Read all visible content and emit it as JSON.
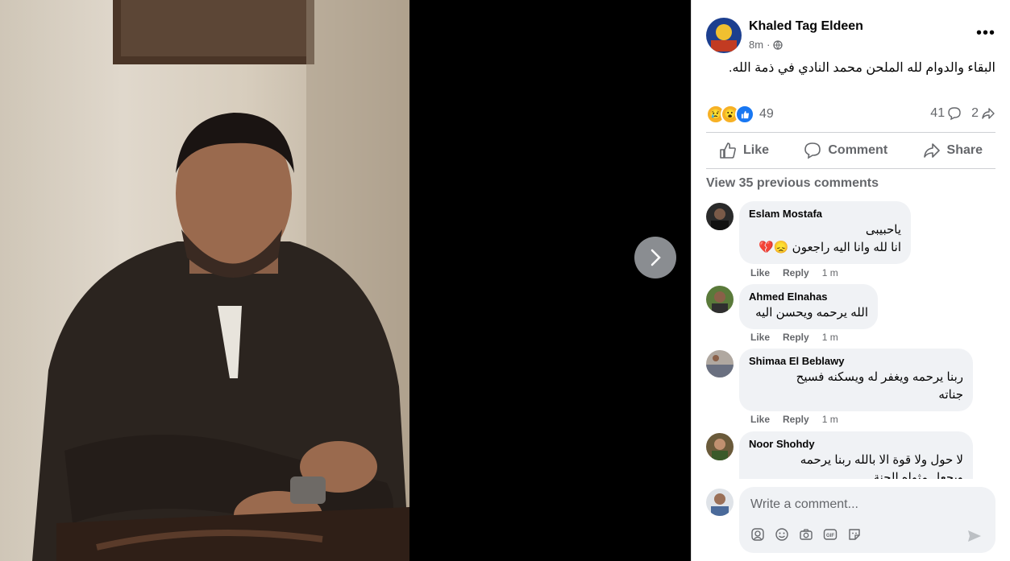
{
  "post": {
    "author": "Khaled Tag Eldeen",
    "time": "8m",
    "privacy_icon": "globe-icon",
    "text": "البقاء والدوام لله الملحن محمد النادي في ذمة الله.",
    "reaction_count": "49",
    "comment_count": "41",
    "share_count": "2"
  },
  "actions": {
    "like": "Like",
    "comment": "Comment",
    "share": "Share"
  },
  "view_previous": "View 35 previous comments",
  "comments": [
    {
      "name": "Eslam Mostafa",
      "lines": [
        "ياحبيبى",
        "انا لله وانا اليه راجعون 😞💔"
      ],
      "like": "Like",
      "reply": "Reply",
      "time": "1 m"
    },
    {
      "name": "Ahmed Elnahas",
      "lines": [
        "الله يرحمه ويحسن اليه"
      ],
      "like": "Like",
      "reply": "Reply",
      "time": "1 m"
    },
    {
      "name": "Shimaa El Beblawy",
      "lines": [
        "ربنا يرحمه ويغفر له ويسكنه فسيح",
        "جناته"
      ],
      "like": "Like",
      "reply": "Reply",
      "time": "1 m"
    },
    {
      "name": "Noor Shohdy",
      "lines": [
        "لا حول ولا قوة الا بالله ربنا يرحمه",
        "ويجعل مثواه الجنة"
      ]
    }
  ],
  "composer": {
    "placeholder": "Write a comment..."
  },
  "colors": {
    "accent": "#1877f2",
    "bubble": "#f0f2f5",
    "muted": "#65676b"
  }
}
